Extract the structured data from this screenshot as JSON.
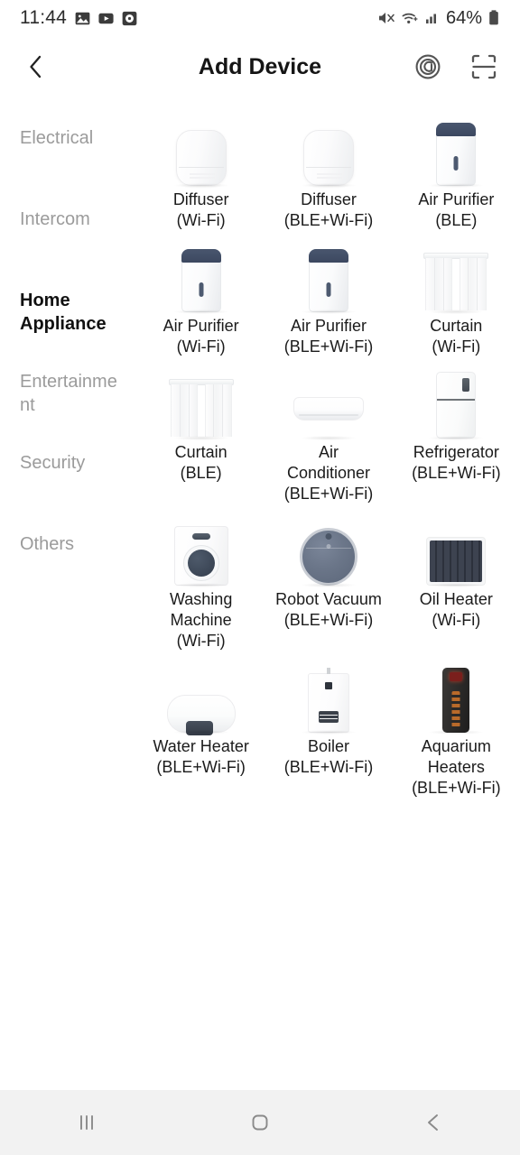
{
  "status_bar": {
    "time": "11:44",
    "battery_percent": "64%",
    "left_icons": [
      "photos-icon",
      "youtube-icon",
      "clock-icon"
    ],
    "right_icons": [
      "mute-icon",
      "wifi-icon",
      "cellular-signal-icon",
      "battery-icon"
    ]
  },
  "app_bar": {
    "title": "Add Device",
    "back_icon": "chevron-left-icon",
    "action_icons": [
      "auto-scan-icon",
      "qr-scan-icon"
    ]
  },
  "sidebar": {
    "items": [
      {
        "label": "Electrical",
        "active": false
      },
      {
        "label": "Intercom",
        "active": false
      },
      {
        "label": "Home Appliance",
        "active": true
      },
      {
        "label": "Entertainment",
        "active": false
      },
      {
        "label": "Security",
        "active": false
      },
      {
        "label": "Others",
        "active": false
      }
    ]
  },
  "devices": [
    {
      "name": "Diffuser",
      "protocol": "(Wi-Fi)",
      "art": "diffuser"
    },
    {
      "name": "Diffuser",
      "protocol": "(BLE+Wi-Fi)",
      "art": "diffuser"
    },
    {
      "name": "Air Purifier",
      "protocol": "(BLE)",
      "art": "purifier"
    },
    {
      "name": "Air Purifier",
      "protocol": "(Wi-Fi)",
      "art": "purifier"
    },
    {
      "name": "Air Purifier",
      "protocol": "(BLE+Wi-Fi)",
      "art": "purifier"
    },
    {
      "name": "Curtain",
      "protocol": "(Wi-Fi)",
      "art": "curtain"
    },
    {
      "name": "Curtain",
      "protocol": "(BLE)",
      "art": "curtain"
    },
    {
      "name": "Air Conditioner",
      "protocol": "(BLE+Wi-Fi)",
      "art": "aircon"
    },
    {
      "name": "Refrigerator",
      "protocol": "(BLE+Wi-Fi)",
      "art": "fridge"
    },
    {
      "name": "Washing Machine",
      "protocol": "(Wi-Fi)",
      "art": "washer"
    },
    {
      "name": "Robot Vacuum",
      "protocol": "(BLE+Wi-Fi)",
      "art": "robot"
    },
    {
      "name": "Oil Heater",
      "protocol": "(Wi-Fi)",
      "art": "oilheater"
    },
    {
      "name": "Water Heater",
      "protocol": "(BLE+Wi-Fi)",
      "art": "waterheater"
    },
    {
      "name": "Boiler",
      "protocol": "(BLE+Wi-Fi)",
      "art": "boiler"
    },
    {
      "name": "Aquarium Heaters",
      "protocol": "(BLE+Wi-Fi)",
      "art": "aqua"
    }
  ],
  "nav_bar": {
    "buttons": [
      "recents-icon",
      "home-icon",
      "back-icon"
    ]
  },
  "colors": {
    "text_primary": "#151515",
    "text_muted": "#9b9b9b",
    "background": "#ffffff",
    "nav_background": "#f2f2f2",
    "device_accent": "#3c4860"
  }
}
